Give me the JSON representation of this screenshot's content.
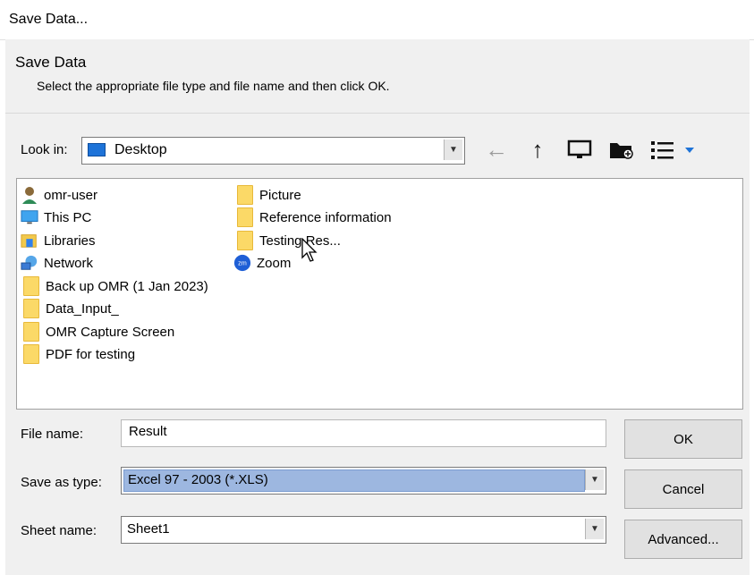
{
  "window": {
    "title": "Save Data..."
  },
  "header": {
    "title": "Save Data",
    "subtitle": "Select the appropriate file type and file name and then click OK."
  },
  "lookin": {
    "label": "Look in:",
    "value": "Desktop"
  },
  "files": {
    "col1": [
      {
        "name": "omr-user",
        "icon": "user-icon"
      },
      {
        "name": "This PC",
        "icon": "computer-icon"
      },
      {
        "name": "Libraries",
        "icon": "libraries-icon"
      },
      {
        "name": "Network",
        "icon": "network-icon"
      },
      {
        "name": "Back up OMR (1 Jan 2023)",
        "icon": "folder-icon"
      },
      {
        "name": "Data_Input_",
        "icon": "folder-icon"
      },
      {
        "name": "OMR Capture Screen",
        "icon": "folder-icon"
      },
      {
        "name": "PDF for testing",
        "icon": "folder-icon"
      }
    ],
    "col2": [
      {
        "name": "Picture",
        "icon": "folder-icon"
      },
      {
        "name": "Reference information",
        "icon": "folder-icon"
      },
      {
        "name": "Testing Res...",
        "icon": "folder-icon"
      },
      {
        "name": "Zoom",
        "icon": "zoom-icon"
      }
    ]
  },
  "form": {
    "file_name_label": "File name:",
    "file_name_value": "Result",
    "save_type_label": "Save as type:",
    "save_type_value": "Excel 97 - 2003 (*.XLS)",
    "sheet_label": "Sheet name:",
    "sheet_value": "Sheet1"
  },
  "buttons": {
    "ok": "OK",
    "cancel": "Cancel",
    "advanced": "Advanced..."
  },
  "colors": {
    "selection": "#9db7e0",
    "folder": "#fbd967",
    "accent": "#1e73d8"
  }
}
